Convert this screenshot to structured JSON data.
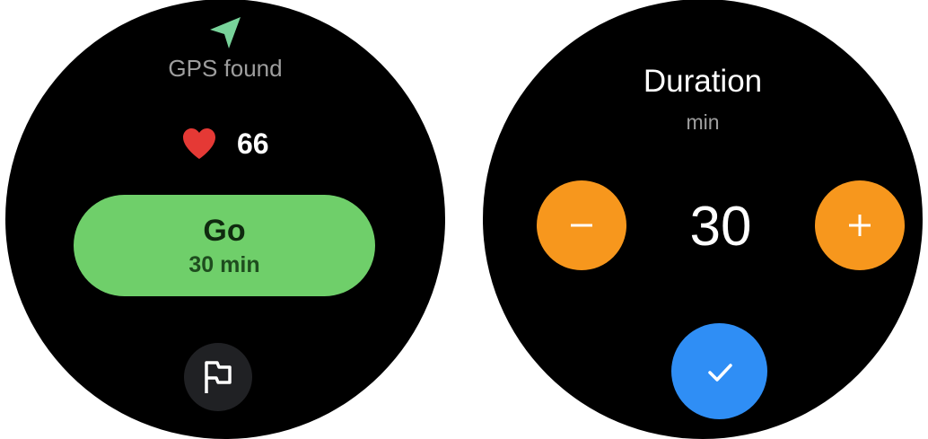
{
  "start_screen": {
    "gps": {
      "icon": "navigation-arrow-icon",
      "label": "GPS found",
      "color": "#78d39a"
    },
    "heart_rate": {
      "icon": "heart-icon",
      "value": "66",
      "color": "#e53935"
    },
    "go_button": {
      "label": "Go",
      "sublabel": "30 min",
      "color": "#6fcf6a"
    },
    "flag_button": {
      "icon": "flag-icon"
    }
  },
  "duration_screen": {
    "title": "Duration",
    "unit": "min",
    "value": "30",
    "decrement_button": {
      "icon": "minus-icon",
      "color": "#f7971d"
    },
    "increment_button": {
      "icon": "plus-icon",
      "color": "#f7971d"
    },
    "confirm_button": {
      "icon": "checkmark-icon",
      "color": "#2f8ef5"
    }
  }
}
